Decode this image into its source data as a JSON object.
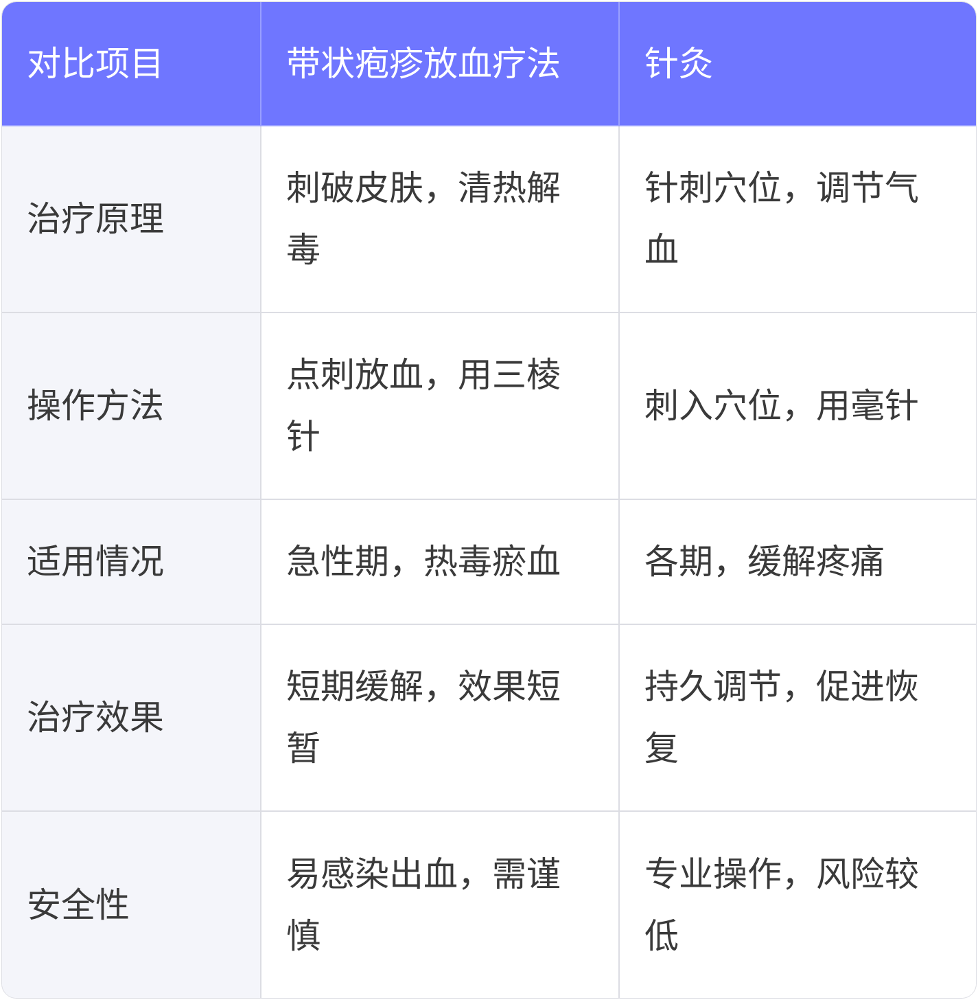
{
  "colors": {
    "header_bg": "#6f76ff",
    "header_text": "#ffffff",
    "label_bg": "#f4f5fa",
    "body_text": "#3a3a3a",
    "border": "#dcdde3"
  },
  "table": {
    "headers": [
      "对比项目",
      "带状疱疹放血疗法",
      "针灸"
    ],
    "rows": [
      [
        "治疗原理",
        "刺破皮肤，清热解毒",
        "针刺穴位，调节气血"
      ],
      [
        "操作方法",
        "点刺放血，用三棱针",
        "刺入穴位，用毫针"
      ],
      [
        "适用情况",
        "急性期，热毒瘀血",
        "各期，缓解疼痛"
      ],
      [
        "治疗效果",
        "短期缓解，效果短暂",
        "持久调节，促进恢复"
      ],
      [
        "安全性",
        "易感染出血，需谨慎",
        "专业操作，风险较低"
      ]
    ]
  }
}
